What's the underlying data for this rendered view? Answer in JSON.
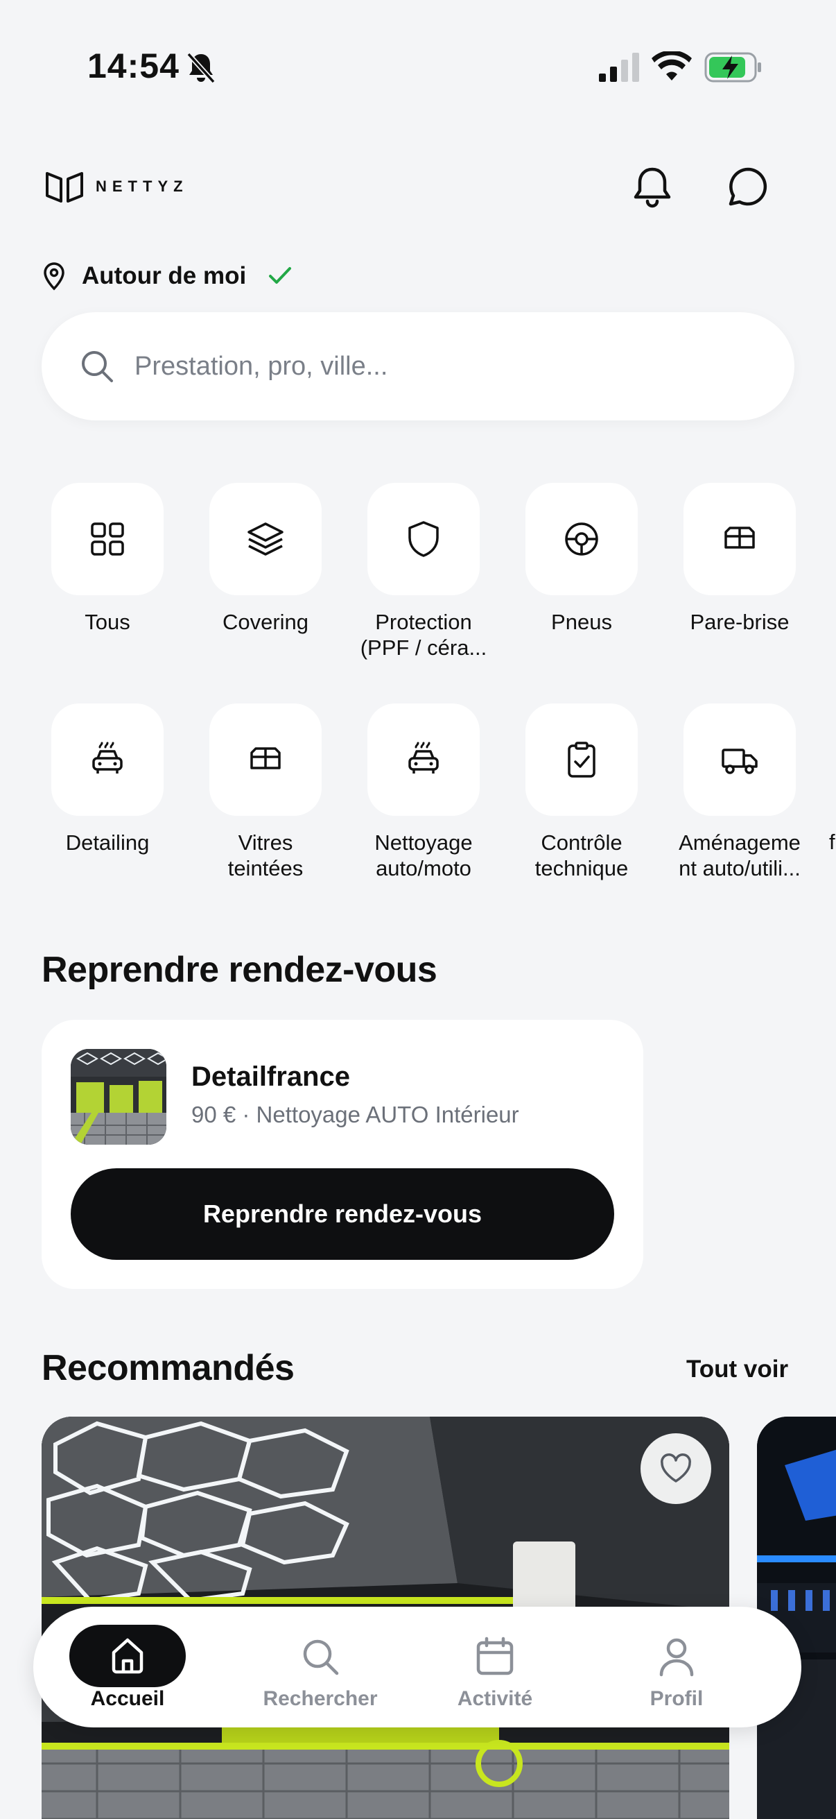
{
  "status": {
    "time": "14:54"
  },
  "header": {
    "brand": "NETTYZ"
  },
  "location": {
    "label": "Autour de moi"
  },
  "search": {
    "placeholder": "Prestation, pro, ville..."
  },
  "categories": [
    {
      "label": "Tous",
      "icon": "grid-icon"
    },
    {
      "label": "Covering",
      "icon": "layers-icon"
    },
    {
      "label": "Protection\n(PPF / céra...",
      "icon": "shield-icon"
    },
    {
      "label": "Pneus",
      "icon": "tire-icon"
    },
    {
      "label": "Pare-brise",
      "icon": "windshield-icon"
    },
    {
      "label": "Detailing",
      "icon": "car-wash-icon"
    },
    {
      "label": "Vitres\nteintées",
      "icon": "tinted-window-icon"
    },
    {
      "label": "Nettoyage\nauto/moto",
      "icon": "car-wash-icon"
    },
    {
      "label": "Contrôle\ntechnique",
      "icon": "clipboard-check-icon"
    },
    {
      "label": "Aménageme\nnt auto/utili...",
      "icon": "truck-icon"
    },
    {
      "label": "f",
      "icon": ""
    }
  ],
  "resume": {
    "title": "Reprendre rendez-vous",
    "card": {
      "name": "Detailfrance",
      "subtitle": "90 € · Nettoyage AUTO Intérieur",
      "button": "Reprendre rendez-vous"
    }
  },
  "recommended": {
    "title": "Recommandés",
    "see_all": "Tout voir"
  },
  "tabbar": {
    "tabs": [
      {
        "label": "Accueil",
        "icon": "home-icon",
        "active": true
      },
      {
        "label": "Rechercher",
        "icon": "search-icon"
      },
      {
        "label": "Activité",
        "icon": "calendar-icon"
      },
      {
        "label": "Profil",
        "icon": "user-icon"
      }
    ]
  },
  "colors": {
    "accent": "#22a846",
    "primary": "#0e0f11",
    "muted": "#8c9098",
    "background": "#f4f5f7"
  }
}
